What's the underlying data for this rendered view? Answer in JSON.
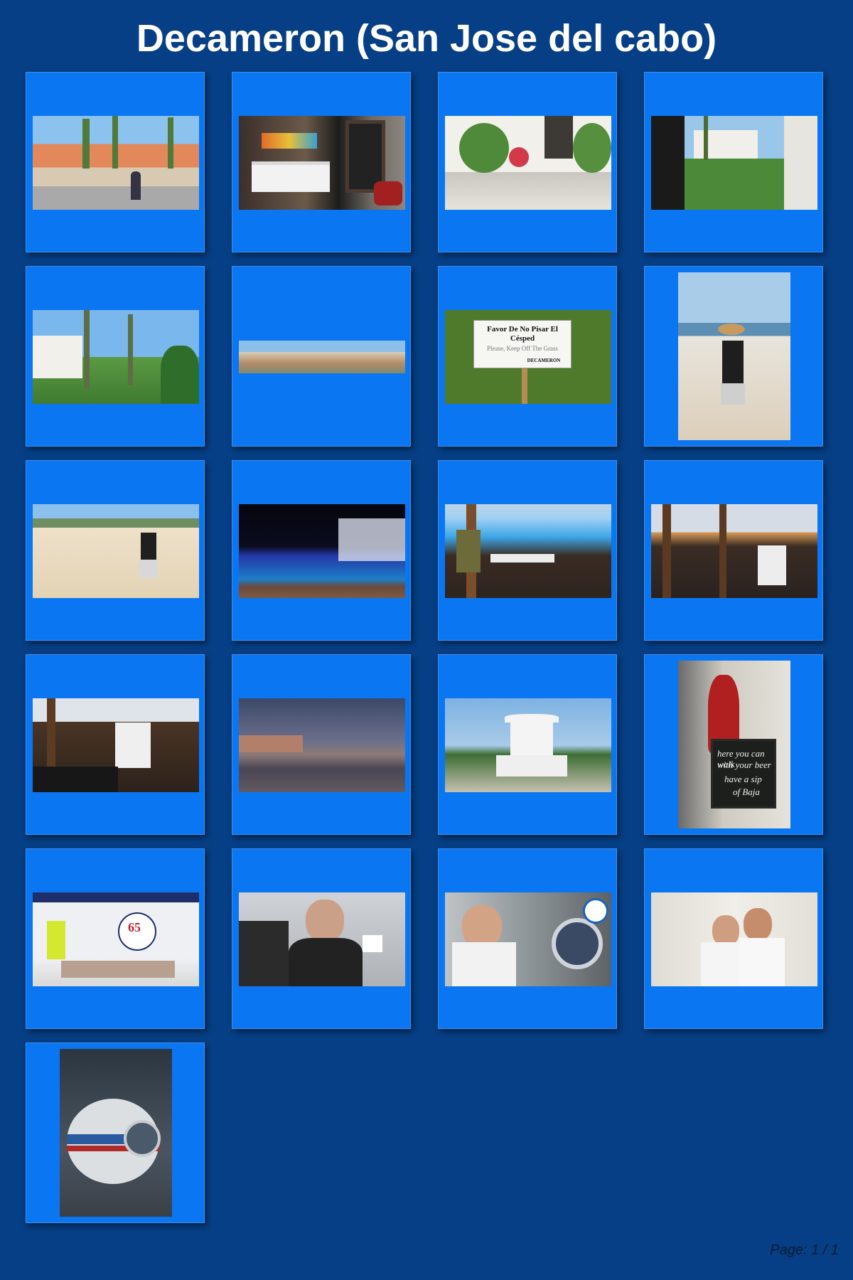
{
  "title": "Decameron (San Jose del cabo)",
  "page_label": "Page: 1 / 1",
  "colors": {
    "background": "#063f85",
    "tile": "#0b76f2",
    "title": "#ffffff"
  },
  "sign": {
    "line1": "Favor De No Pisar El",
    "line2": "Césped",
    "line3": "Please, Keep Off The Grass",
    "brand": "DECAMERON"
  },
  "chalkboard": {
    "line1": "here you can walk",
    "line2": "with your beer",
    "line3": "have a sip",
    "line4": "of Baja"
  },
  "banner": {
    "number": "65"
  }
}
